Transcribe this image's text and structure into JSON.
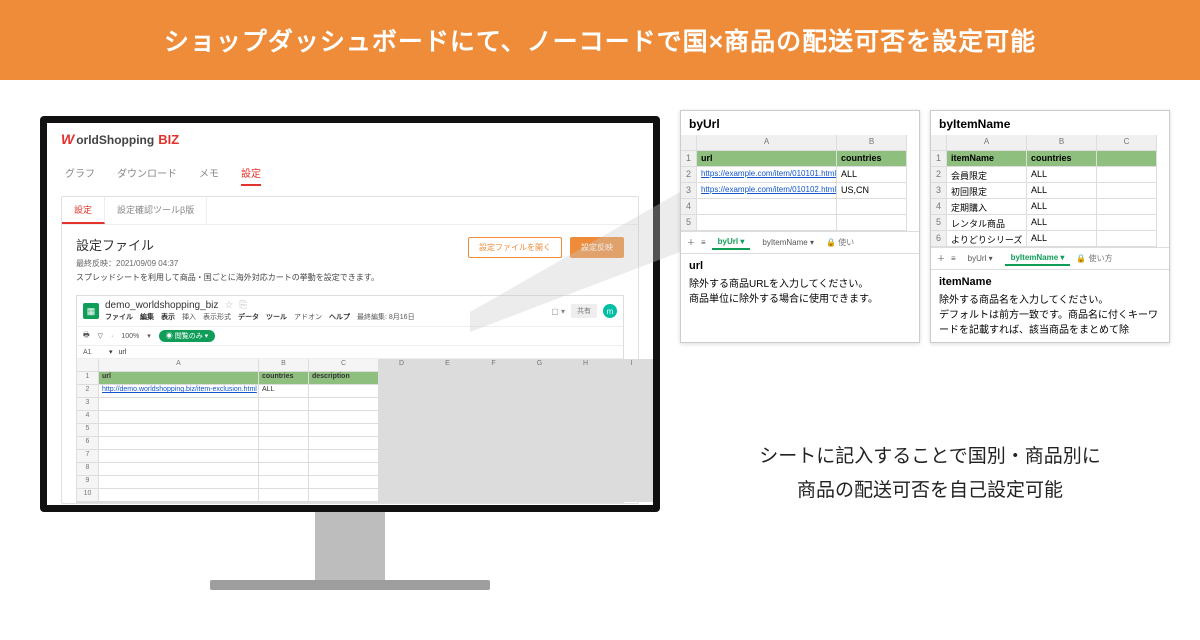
{
  "banner": "ショップダッシュボードにて、ノーコードで国×商品の配送可否を設定可能",
  "logo": {
    "w": "W",
    "orldshopping": "orldShopping",
    "biz": "BIZ"
  },
  "top_tabs": [
    "グラフ",
    "ダウンロード",
    "メモ",
    "設定"
  ],
  "top_tabs_active": 3,
  "sub_tabs": [
    "設定",
    "設定確認ツールβ版"
  ],
  "sub_tabs_active": 0,
  "section_title": "設定ファイル",
  "last_reflected": "最終反映：2021/09/09 04:37",
  "description": "スプレッドシートを利用して商品・国ごとに海外対応カートの挙動を設定できます。",
  "btn_open": "設定ファイルを開く",
  "btn_reflect": "設定反映",
  "sheet": {
    "name": "demo_worldshopping_biz",
    "menu": [
      "ファイル",
      "編集",
      "表示",
      "挿入",
      "表示形式",
      "データ",
      "ツール",
      "アドオン",
      "ヘルプ"
    ],
    "last_edit": "最終編集: 8月16日",
    "zoom": "100%",
    "view_only": "閲覧のみ",
    "share": "共有",
    "avatar": "m",
    "cell_ref": "A1",
    "formula": "url",
    "cols": [
      "",
      "A",
      "B",
      "C",
      "D",
      "E",
      "F",
      "G",
      "H",
      "I"
    ],
    "headers": [
      "url",
      "countries",
      "description"
    ],
    "row1": {
      "url": "http://demo.worldshopping.biz/item-exclusion.html",
      "countries": "ALL",
      "description": ""
    }
  },
  "mini_left": {
    "title": "byUrl",
    "cols": [
      "",
      "A",
      "B"
    ],
    "headers": [
      "url",
      "countries"
    ],
    "rows": [
      {
        "url": "https://example.com/item/010101.html",
        "countries": "ALL"
      },
      {
        "url": "https://example.com/item/010102.html",
        "countries": "US,CN"
      }
    ],
    "tabs": {
      "byUrl": "byUrl",
      "byItemName": "byItemName",
      "lock": "使い"
    },
    "caption_label": "url",
    "caption_text": "除外する商品URLを入力してください。\n商品単位に除外する場合に使用できます。"
  },
  "mini_right": {
    "title": "byItemName",
    "cols": [
      "",
      "A",
      "B",
      "C"
    ],
    "headers": [
      "itemName",
      "countries",
      ""
    ],
    "rows": [
      {
        "name": "会員限定",
        "countries": "ALL"
      },
      {
        "name": "初回限定",
        "countries": "ALL"
      },
      {
        "name": "定期購入",
        "countries": "ALL"
      },
      {
        "name": "レンタル商品",
        "countries": "ALL"
      },
      {
        "name": "よりどりシリーズ",
        "countries": "ALL"
      }
    ],
    "tabs": {
      "byUrl": "byUrl",
      "byItemName": "byItemName",
      "lock": "使い方"
    },
    "caption_label": "itemName",
    "caption_text": "除外する商品名を入力してください。\nデフォルトは前方一致です。商品名に付くキーワードを記載すれば、該当商品をまとめて除"
  },
  "bottom_text_1": "シートに記入することで国別・商品別に",
  "bottom_text_2": "商品の配送可否を自己設定可能"
}
